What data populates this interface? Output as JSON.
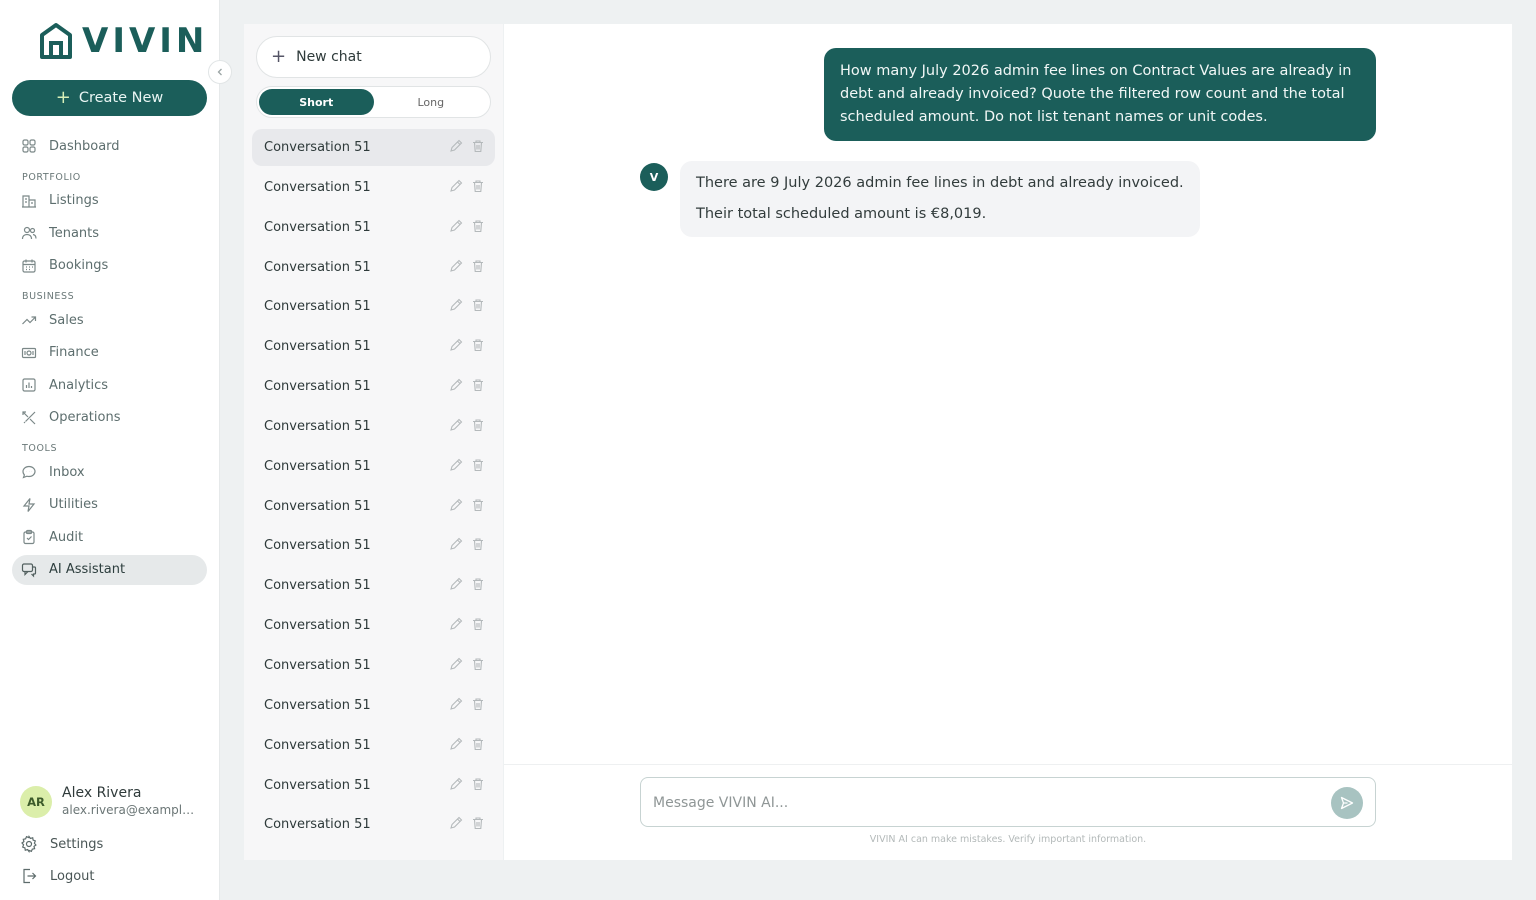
{
  "brand": {
    "name": "VIVIN",
    "color": "#1b5e5a"
  },
  "sidebar": {
    "create_label": "Create New",
    "items": [
      {
        "label": "Dashboard",
        "icon": "grid-icon"
      },
      {
        "section": "PORTFOLIO"
      },
      {
        "label": "Listings",
        "icon": "building-icon"
      },
      {
        "label": "Tenants",
        "icon": "users-icon"
      },
      {
        "label": "Bookings",
        "icon": "calendar-icon"
      },
      {
        "section": "BUSINESS"
      },
      {
        "label": "Sales",
        "icon": "trend-icon"
      },
      {
        "label": "Finance",
        "icon": "banknote-icon"
      },
      {
        "label": "Analytics",
        "icon": "bar-chart-icon"
      },
      {
        "label": "Operations",
        "icon": "tools-icon"
      },
      {
        "section": "TOOLS"
      },
      {
        "label": "Inbox",
        "icon": "message-icon"
      },
      {
        "label": "Utilities",
        "icon": "bolt-icon"
      },
      {
        "label": "Audit",
        "icon": "clipboard-icon"
      },
      {
        "label": "AI Assistant",
        "icon": "chat-icon",
        "active": true
      }
    ],
    "user": {
      "initials": "AR",
      "name": "Alex Rivera",
      "email": "alex.rivera@example.com"
    },
    "settings_label": "Settings",
    "logout_label": "Logout"
  },
  "conversations": {
    "new_chat_label": "New chat",
    "modes": {
      "short": "Short",
      "long": "Long",
      "selected": "Short"
    },
    "items": [
      "Conversation 51",
      "Conversation 51",
      "Conversation 51",
      "Conversation 51",
      "Conversation 51",
      "Conversation 51",
      "Conversation 51",
      "Conversation 51",
      "Conversation 51",
      "Conversation 51",
      "Conversation 51",
      "Conversation 51",
      "Conversation 51",
      "Conversation 51",
      "Conversation 51",
      "Conversation 51",
      "Conversation 51",
      "Conversation 51"
    ]
  },
  "chat": {
    "user_message": "How many July 2026 admin fee lines on Contract Values are already in debt and already invoiced? Quote the filtered row count and the total scheduled amount. Do not list tenant names or unit codes.",
    "assistant_initial": "V",
    "assistant_lines": [
      "There are 9 July 2026 admin fee lines in debt and already invoiced.",
      "Their total scheduled amount is €8,019."
    ],
    "input_placeholder": "Message VIVIN AI...",
    "disclaimer": "VIVIN AI can make mistakes. Verify important information."
  }
}
